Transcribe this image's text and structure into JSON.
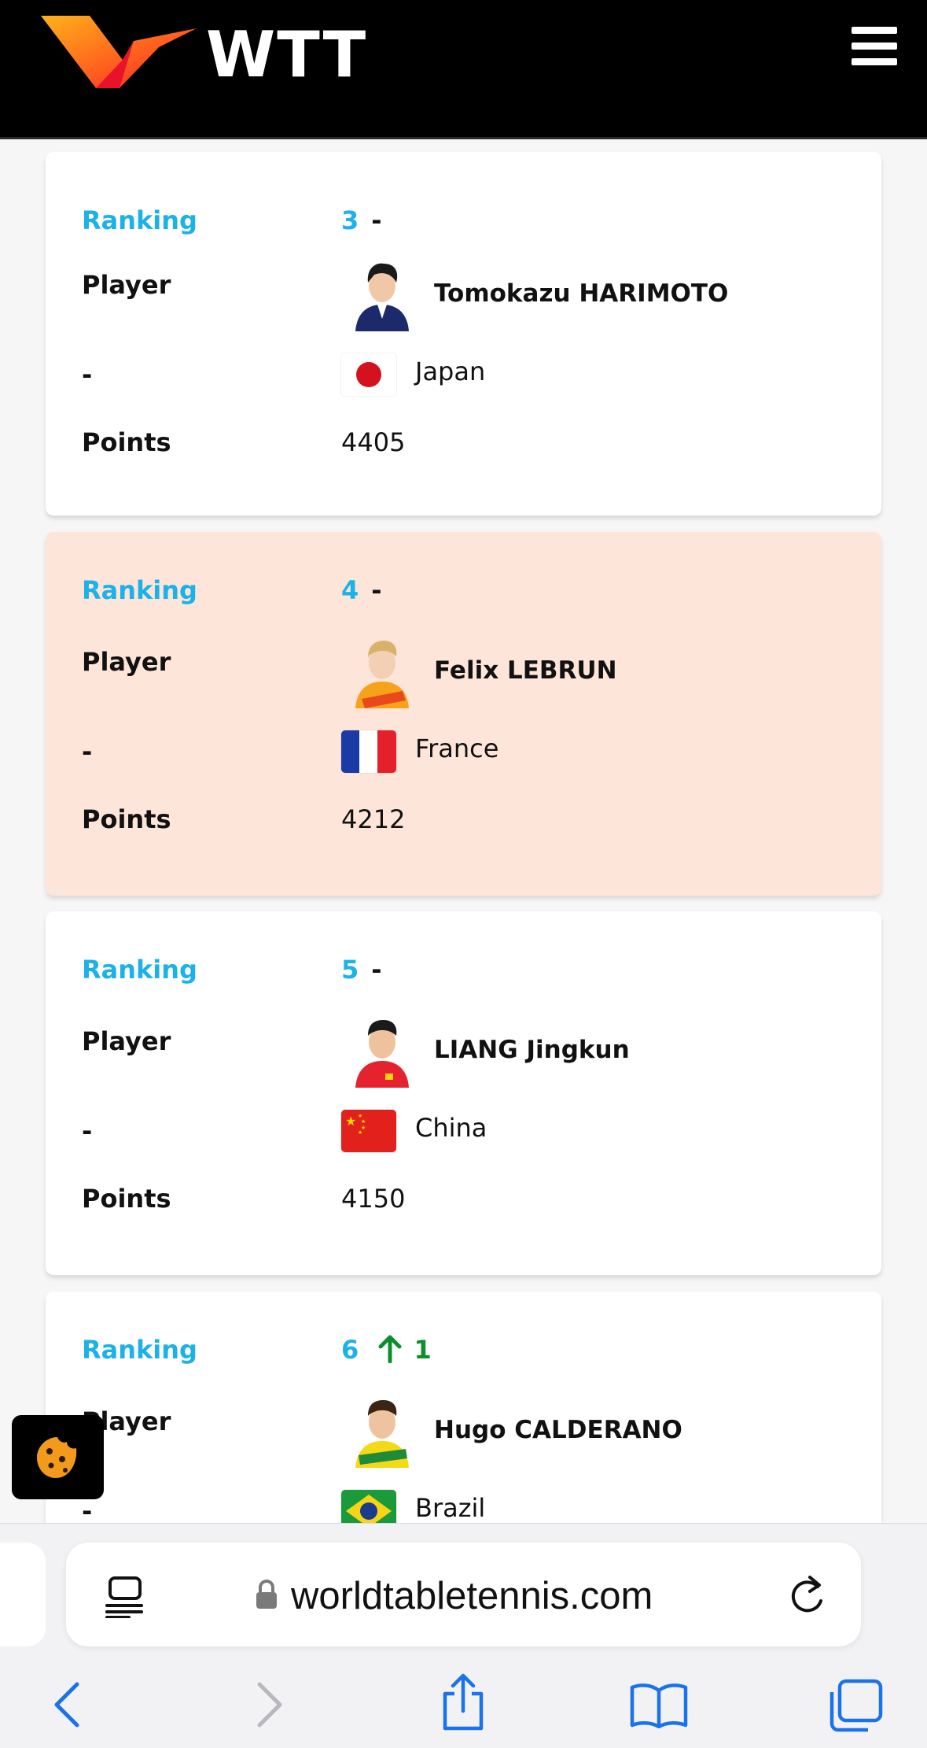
{
  "header": {
    "brand": "WTT",
    "logo_icon": "wtt-logo-icon",
    "menu_icon": "hamburger-menu-icon"
  },
  "labels": {
    "ranking": "Ranking",
    "player": "Player",
    "country": "-",
    "points": "Points"
  },
  "rankings": [
    {
      "rank": "3",
      "change": "-",
      "player": "Tomokazu HARIMOTO",
      "country": "Japan",
      "points": "4405",
      "highlighted": false
    },
    {
      "rank": "4",
      "change": "-",
      "player": "Felix LEBRUN",
      "country": "France",
      "points": "4212",
      "highlighted": true
    },
    {
      "rank": "5",
      "change": "-",
      "player": "LIANG Jingkun",
      "country": "China",
      "points": "4150",
      "highlighted": false
    },
    {
      "rank": "6",
      "change_icon": "arrow-up-icon",
      "change": "1",
      "player": "Hugo CALDERANO",
      "country": "Brazil",
      "points": "",
      "highlighted": false
    }
  ],
  "cookie_button": {
    "icon": "cookie-icon"
  },
  "browser": {
    "url": "worldtabletennis.com",
    "icons": [
      "reader-view-icon",
      "lock-icon",
      "reload-icon",
      "back-icon",
      "forward-icon",
      "share-icon",
      "bookmarks-icon",
      "tabs-icon"
    ]
  },
  "colors": {
    "accent_blue": "#1cb2e8",
    "highlight_row": "#fde5da",
    "up_green": "#0e8f2e",
    "safari_blue": "#1a73e8"
  }
}
